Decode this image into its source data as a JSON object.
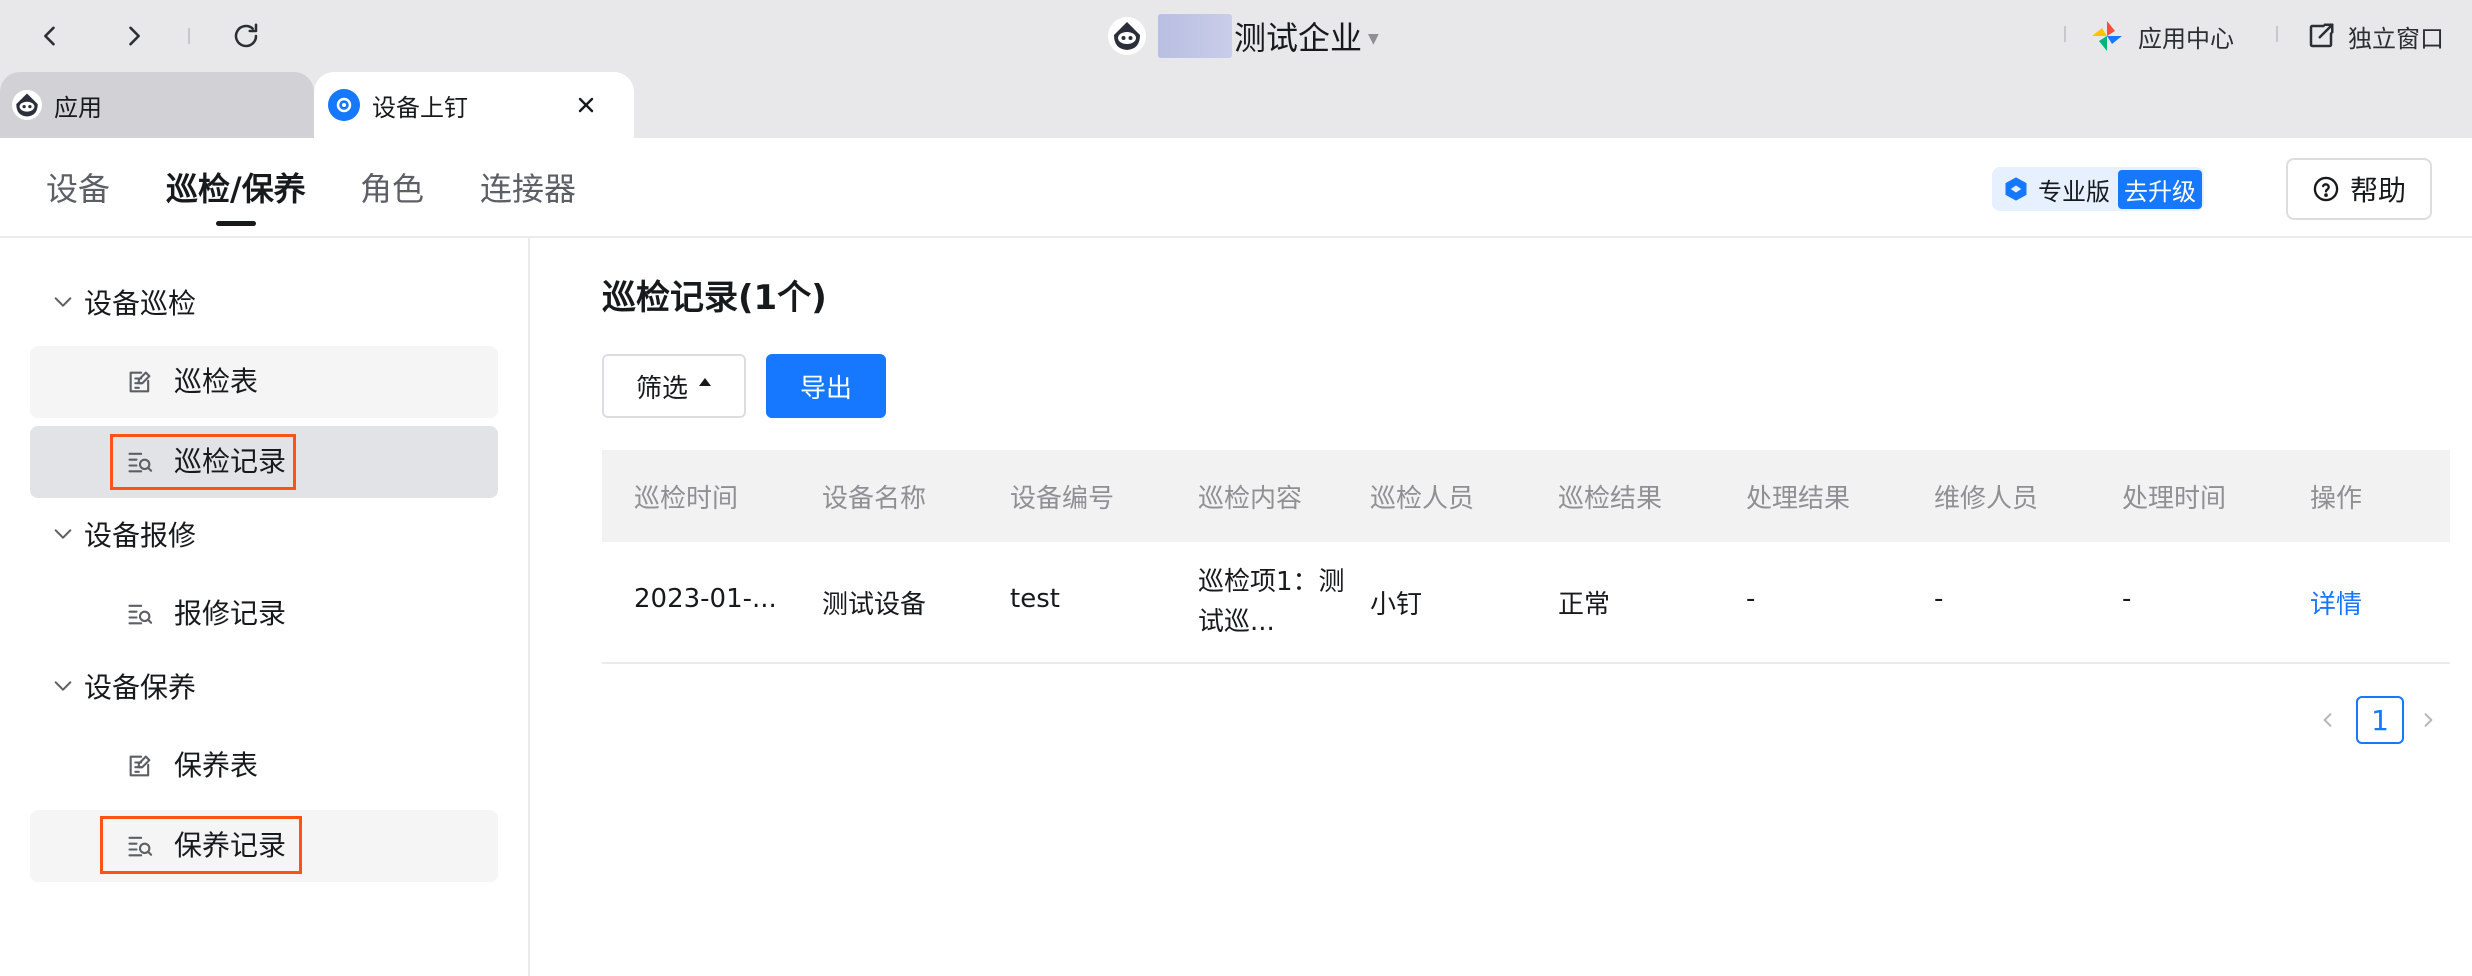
{
  "titlebar": {
    "app_title": "测试企业",
    "app_center_label": "应用中心",
    "window_label": "独立窗口"
  },
  "tabs": [
    {
      "label": "应用"
    },
    {
      "label": "设备上钉"
    }
  ],
  "header": {
    "tabs": [
      {
        "label": "设备"
      },
      {
        "label": "巡检/保养"
      },
      {
        "label": "角色"
      },
      {
        "label": "连接器"
      }
    ],
    "active_tab": "巡检/保养",
    "pro_label": "专业版",
    "upgrade_label": "去升级",
    "help_label": "帮助"
  },
  "sidebar": {
    "groups": [
      {
        "label": "设备巡检",
        "items": [
          {
            "label": "巡检表"
          },
          {
            "label": "巡检记录",
            "selected": true
          }
        ]
      },
      {
        "label": "设备报修",
        "items": [
          {
            "label": "报修记录"
          }
        ]
      },
      {
        "label": "设备保养",
        "items": [
          {
            "label": "保养表"
          },
          {
            "label": "保养记录"
          }
        ]
      }
    ]
  },
  "main": {
    "title": "巡检记录(1个)",
    "filter_label": "筛选",
    "export_label": "导出",
    "table": {
      "columns": [
        "巡检时间",
        "设备名称",
        "设备编号",
        "巡检内容",
        "巡检人员",
        "巡检结果",
        "处理结果",
        "维修人员",
        "处理时间",
        "操作"
      ],
      "rows": [
        {
          "time": "2023-01-...",
          "device_name": "测试设备",
          "device_id": "test",
          "content": "巡检项1：测试巡...",
          "inspector": "小钉",
          "result": "正常",
          "handle_result": "-",
          "repairer": "-",
          "handle_time": "-",
          "action": "详情"
        }
      ]
    },
    "pagination": {
      "current_page": "1"
    }
  },
  "colors": {
    "accent": "#1677ff",
    "highlight": "#ff5316",
    "titlebar_bg": "#e8e8ea"
  }
}
